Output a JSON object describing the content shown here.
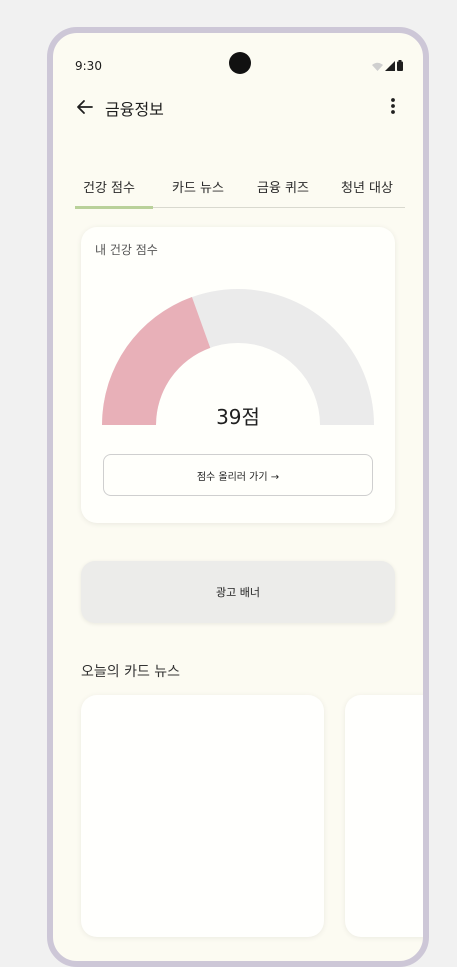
{
  "status_bar": {
    "time": "9:30"
  },
  "app_bar": {
    "title": "금융정보",
    "back_icon": "arrow-left-icon",
    "menu_icon": "more-vertical-icon"
  },
  "tabs": [
    {
      "label": "건강 점수",
      "selected": true
    },
    {
      "label": "카드 뉴스",
      "selected": false
    },
    {
      "label": "금융 퀴즈",
      "selected": false
    },
    {
      "label": "청년 대상",
      "selected": false
    }
  ],
  "health_score": {
    "card_title": "내 건강 점수",
    "score_text": "39점",
    "score_value": 39,
    "score_max": 100,
    "gauge_fill_color": "#e8b0b8",
    "gauge_track_color": "#ebebeb",
    "button_label": "점수 올리러 가기 →"
  },
  "ad_banner": {
    "label": "광고 배너"
  },
  "card_news": {
    "heading": "오늘의 카드 뉴스"
  },
  "colors": {
    "tab_indicator": "#b9d19a",
    "background": "#fcfbf2",
    "frame": "#cdc7d7"
  }
}
